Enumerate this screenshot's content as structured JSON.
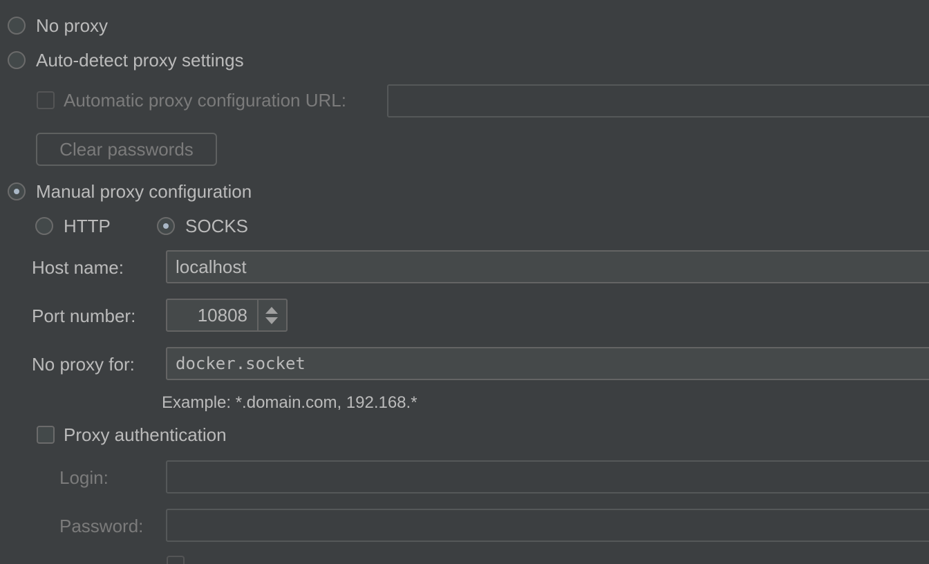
{
  "proxy_mode": {
    "no_proxy_label": "No proxy",
    "auto_detect_label": "Auto-detect proxy settings",
    "manual_label": "Manual proxy configuration",
    "selected": "manual"
  },
  "auto_config": {
    "checkbox_label": "Automatic proxy configuration URL:",
    "checked": false,
    "url_value": "",
    "clear_passwords_label": "Clear passwords"
  },
  "protocol": {
    "http_label": "HTTP",
    "socks_label": "SOCKS",
    "selected": "SOCKS"
  },
  "fields": {
    "host_label": "Host name:",
    "host_value": "localhost",
    "port_label": "Port number:",
    "port_value": "10808",
    "no_proxy_label": "No proxy for:",
    "no_proxy_value": "docker.socket",
    "example_text": "Example: *.domain.com, 192.168.*"
  },
  "auth": {
    "checkbox_label": "Proxy authentication",
    "checked": false,
    "login_label": "Login:",
    "login_value": "",
    "password_label": "Password:",
    "password_value": ""
  },
  "colors": {
    "background": "#3c3f41",
    "text": "#bbbbbb",
    "disabled_text": "#7b7b7b",
    "field_border": "#646464"
  }
}
